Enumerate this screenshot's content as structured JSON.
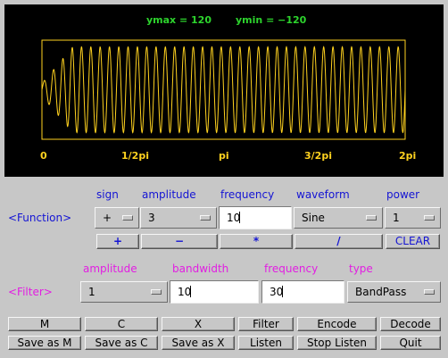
{
  "plot": {
    "ymax_label": "ymax = 120",
    "ymin_label": "ymin = −120",
    "x_ticks": [
      "0",
      "1/2pi",
      "pi",
      "3/2pi",
      "2pi"
    ],
    "colors": {
      "background": "#000000",
      "frame": "#ffd21f",
      "wave": "#ffd21f",
      "limits": "#2dd42d"
    },
    "waveform": {
      "type": "sine",
      "cycles_visible": 39,
      "ramp_in": "amplitude grows over first ~10% of span"
    }
  },
  "function_section": {
    "row_label": "<Function>",
    "headers": {
      "sign": "sign",
      "amplitude": "amplitude",
      "frequency": "frequency",
      "waveform": "waveform",
      "power": "power"
    },
    "sign_value": "+",
    "amplitude_value": "3",
    "frequency_value": "10",
    "waveform_value": "Sine",
    "power_value": "1",
    "ops": {
      "plus": "+",
      "minus": "−",
      "times": "*",
      "divide": "/",
      "clear": "CLEAR"
    }
  },
  "filter_section": {
    "row_label": "<Filter>",
    "headers": {
      "amplitude": "amplitude",
      "bandwidth": "bandwidth",
      "frequency": "frequency",
      "type": "type"
    },
    "amplitude_value": "1",
    "bandwidth_value": "10",
    "frequency_value": "30",
    "type_value": "BandPass"
  },
  "buttons_row1": {
    "m": "M",
    "c": "C",
    "x": "X",
    "filter": "Filter",
    "encode": "Encode",
    "decode": "Decode"
  },
  "buttons_row2": {
    "save_m": "Save as M",
    "save_c": "Save as C",
    "save_x": "Save as X",
    "listen": "Listen",
    "stop_listen": "Stop Listen",
    "quit": "Quit"
  }
}
